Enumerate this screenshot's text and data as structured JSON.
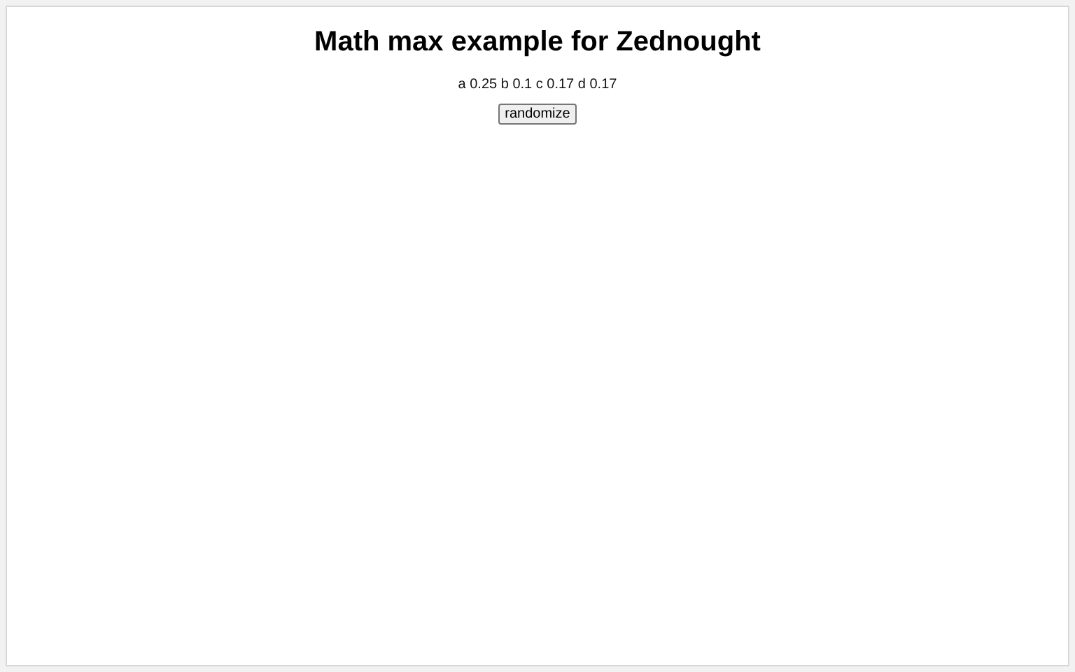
{
  "title": "Math max example for Zednought",
  "values": [
    {
      "name": "a",
      "value": "0.25"
    },
    {
      "name": "b",
      "value": "0.1"
    },
    {
      "name": "c",
      "value": "0.17"
    },
    {
      "name": "d",
      "value": "0.17"
    }
  ],
  "button": "randomize"
}
